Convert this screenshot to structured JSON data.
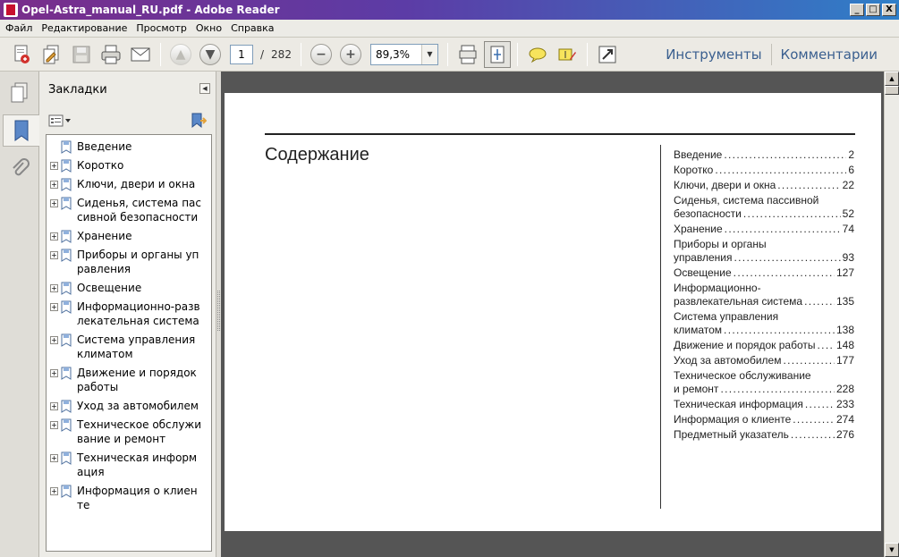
{
  "window": {
    "title": "Opel-Astra_manual_RU.pdf - Adobe Reader",
    "controls": [
      "_",
      "□",
      "X"
    ]
  },
  "menu": [
    "Файл",
    "Редактирование",
    "Просмотр",
    "Окно",
    "Справка"
  ],
  "toolbar": {
    "current_page": "1",
    "page_separator": "/",
    "total_pages": "282",
    "zoom": "89,3%",
    "tools_label": "Инструменты",
    "comments_label": "Комментарии"
  },
  "bookmarks": {
    "title": "Закладки",
    "items": [
      {
        "label": "Введение",
        "expandable": false
      },
      {
        "label": "Коротко",
        "expandable": true
      },
      {
        "label": "Ключи, двери и окна",
        "expandable": true
      },
      {
        "label": "Сиденья, система пассивной безопасности",
        "expandable": true
      },
      {
        "label": "Хранение",
        "expandable": true
      },
      {
        "label": "Приборы и органы управления",
        "expandable": true
      },
      {
        "label": "Освещение",
        "expandable": true
      },
      {
        "label": "Информационно-развлекательная система",
        "expandable": true
      },
      {
        "label": "Система управления климатом",
        "expandable": true
      },
      {
        "label": "Движение и порядок работы",
        "expandable": true
      },
      {
        "label": "Уход за автомобилем",
        "expandable": true
      },
      {
        "label": "Техническое обслуживание и ремонт",
        "expandable": true
      },
      {
        "label": "Техническая информация",
        "expandable": true
      },
      {
        "label": "Информация о клиенте",
        "expandable": true
      }
    ]
  },
  "document": {
    "heading": "Содержание",
    "toc": [
      {
        "lines": [
          "Введение"
        ],
        "page": "2"
      },
      {
        "lines": [
          "Коротко"
        ],
        "page": "6"
      },
      {
        "lines": [
          "Ключи, двери и окна"
        ],
        "page": "22"
      },
      {
        "lines": [
          "Сиденья, система пассивной",
          "безопасности"
        ],
        "page": "52"
      },
      {
        "lines": [
          "Хранение"
        ],
        "page": "74"
      },
      {
        "lines": [
          "Приборы и органы",
          "управления"
        ],
        "page": "93"
      },
      {
        "lines": [
          "Освещение"
        ],
        "page": "127"
      },
      {
        "lines": [
          "Информационно-",
          "развлекательная система"
        ],
        "page": "135"
      },
      {
        "lines": [
          "Система управления",
          "климатом"
        ],
        "page": "138"
      },
      {
        "lines": [
          "Движение и порядок работы"
        ],
        "page": "148"
      },
      {
        "lines": [
          "Уход за автомобилем"
        ],
        "page": "177"
      },
      {
        "lines": [
          "Техническое обслуживание",
          "и ремонт"
        ],
        "page": "228"
      },
      {
        "lines": [
          "Техническая информация"
        ],
        "page": "233"
      },
      {
        "lines": [
          "Информация о клиенте"
        ],
        "page": "274"
      },
      {
        "lines": [
          "Предметный указатель"
        ],
        "page": "276"
      }
    ]
  },
  "icons": {
    "create": "create-pdf-icon",
    "edit": "edit-icon",
    "save": "save-icon",
    "print": "print-icon",
    "email": "email-icon",
    "prev": "prev-page-icon",
    "next": "next-page-icon",
    "zoom_out": "zoom-out-icon",
    "zoom_in": "zoom-in-icon",
    "fit_page": "fit-page-icon",
    "fit_width": "fit-width-icon",
    "comment": "comment-icon",
    "highlight": "highlight-icon",
    "fullscreen": "fullscreen-icon"
  }
}
